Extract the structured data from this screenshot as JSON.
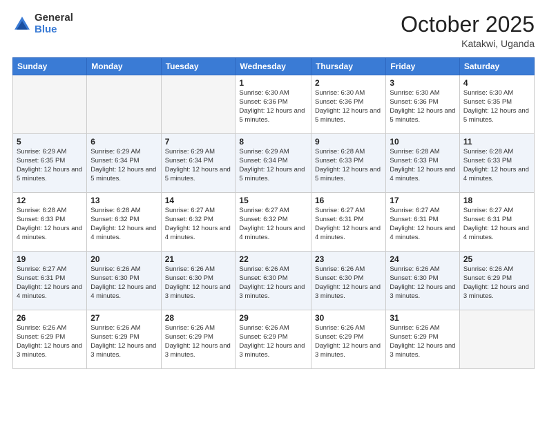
{
  "header": {
    "logo_general": "General",
    "logo_blue": "Blue",
    "month": "October 2025",
    "location": "Katakwi, Uganda"
  },
  "weekdays": [
    "Sunday",
    "Monday",
    "Tuesday",
    "Wednesday",
    "Thursday",
    "Friday",
    "Saturday"
  ],
  "rows": [
    {
      "shade": false,
      "cells": [
        {
          "empty": true
        },
        {
          "empty": true
        },
        {
          "empty": true
        },
        {
          "day": "1",
          "sunrise": "6:30 AM",
          "sunset": "6:36 PM",
          "daylight": "12 hours and 5 minutes."
        },
        {
          "day": "2",
          "sunrise": "6:30 AM",
          "sunset": "6:36 PM",
          "daylight": "12 hours and 5 minutes."
        },
        {
          "day": "3",
          "sunrise": "6:30 AM",
          "sunset": "6:36 PM",
          "daylight": "12 hours and 5 minutes."
        },
        {
          "day": "4",
          "sunrise": "6:30 AM",
          "sunset": "6:35 PM",
          "daylight": "12 hours and 5 minutes."
        }
      ]
    },
    {
      "shade": true,
      "cells": [
        {
          "day": "5",
          "sunrise": "6:29 AM",
          "sunset": "6:35 PM",
          "daylight": "12 hours and 5 minutes."
        },
        {
          "day": "6",
          "sunrise": "6:29 AM",
          "sunset": "6:34 PM",
          "daylight": "12 hours and 5 minutes."
        },
        {
          "day": "7",
          "sunrise": "6:29 AM",
          "sunset": "6:34 PM",
          "daylight": "12 hours and 5 minutes."
        },
        {
          "day": "8",
          "sunrise": "6:29 AM",
          "sunset": "6:34 PM",
          "daylight": "12 hours and 5 minutes."
        },
        {
          "day": "9",
          "sunrise": "6:28 AM",
          "sunset": "6:33 PM",
          "daylight": "12 hours and 5 minutes."
        },
        {
          "day": "10",
          "sunrise": "6:28 AM",
          "sunset": "6:33 PM",
          "daylight": "12 hours and 4 minutes."
        },
        {
          "day": "11",
          "sunrise": "6:28 AM",
          "sunset": "6:33 PM",
          "daylight": "12 hours and 4 minutes."
        }
      ]
    },
    {
      "shade": false,
      "cells": [
        {
          "day": "12",
          "sunrise": "6:28 AM",
          "sunset": "6:33 PM",
          "daylight": "12 hours and 4 minutes."
        },
        {
          "day": "13",
          "sunrise": "6:28 AM",
          "sunset": "6:32 PM",
          "daylight": "12 hours and 4 minutes."
        },
        {
          "day": "14",
          "sunrise": "6:27 AM",
          "sunset": "6:32 PM",
          "daylight": "12 hours and 4 minutes."
        },
        {
          "day": "15",
          "sunrise": "6:27 AM",
          "sunset": "6:32 PM",
          "daylight": "12 hours and 4 minutes."
        },
        {
          "day": "16",
          "sunrise": "6:27 AM",
          "sunset": "6:31 PM",
          "daylight": "12 hours and 4 minutes."
        },
        {
          "day": "17",
          "sunrise": "6:27 AM",
          "sunset": "6:31 PM",
          "daylight": "12 hours and 4 minutes."
        },
        {
          "day": "18",
          "sunrise": "6:27 AM",
          "sunset": "6:31 PM",
          "daylight": "12 hours and 4 minutes."
        }
      ]
    },
    {
      "shade": true,
      "cells": [
        {
          "day": "19",
          "sunrise": "6:27 AM",
          "sunset": "6:31 PM",
          "daylight": "12 hours and 4 minutes."
        },
        {
          "day": "20",
          "sunrise": "6:26 AM",
          "sunset": "6:30 PM",
          "daylight": "12 hours and 4 minutes."
        },
        {
          "day": "21",
          "sunrise": "6:26 AM",
          "sunset": "6:30 PM",
          "daylight": "12 hours and 3 minutes."
        },
        {
          "day": "22",
          "sunrise": "6:26 AM",
          "sunset": "6:30 PM",
          "daylight": "12 hours and 3 minutes."
        },
        {
          "day": "23",
          "sunrise": "6:26 AM",
          "sunset": "6:30 PM",
          "daylight": "12 hours and 3 minutes."
        },
        {
          "day": "24",
          "sunrise": "6:26 AM",
          "sunset": "6:30 PM",
          "daylight": "12 hours and 3 minutes."
        },
        {
          "day": "25",
          "sunrise": "6:26 AM",
          "sunset": "6:29 PM",
          "daylight": "12 hours and 3 minutes."
        }
      ]
    },
    {
      "shade": false,
      "cells": [
        {
          "day": "26",
          "sunrise": "6:26 AM",
          "sunset": "6:29 PM",
          "daylight": "12 hours and 3 minutes."
        },
        {
          "day": "27",
          "sunrise": "6:26 AM",
          "sunset": "6:29 PM",
          "daylight": "12 hours and 3 minutes."
        },
        {
          "day": "28",
          "sunrise": "6:26 AM",
          "sunset": "6:29 PM",
          "daylight": "12 hours and 3 minutes."
        },
        {
          "day": "29",
          "sunrise": "6:26 AM",
          "sunset": "6:29 PM",
          "daylight": "12 hours and 3 minutes."
        },
        {
          "day": "30",
          "sunrise": "6:26 AM",
          "sunset": "6:29 PM",
          "daylight": "12 hours and 3 minutes."
        },
        {
          "day": "31",
          "sunrise": "6:26 AM",
          "sunset": "6:29 PM",
          "daylight": "12 hours and 3 minutes."
        },
        {
          "empty": true
        }
      ]
    }
  ]
}
